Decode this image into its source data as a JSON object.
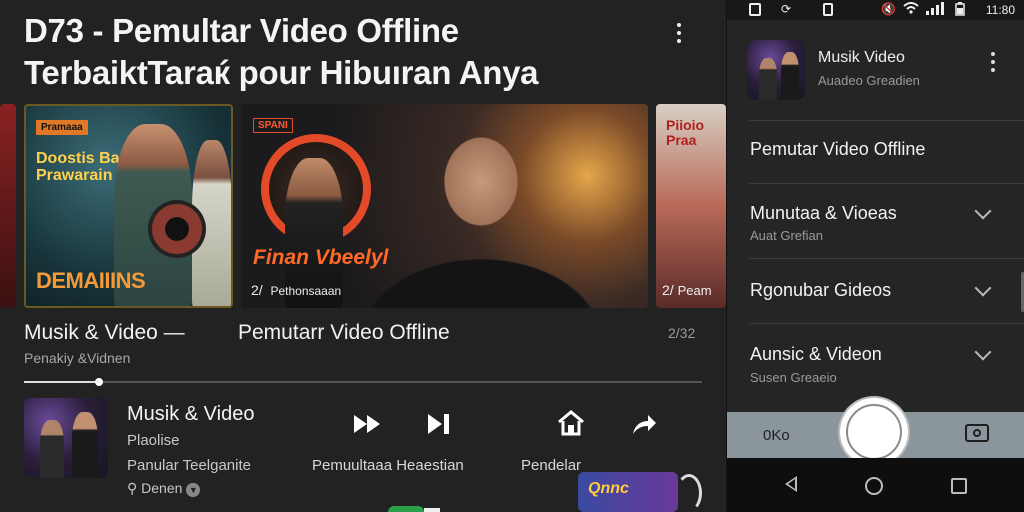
{
  "header": {
    "title_line1": "D73 - Pemultar Video Offline",
    "title_line2": "TerbaiktTaraќ pour Hibuıran Anya"
  },
  "carousel": {
    "items": [
      {
        "badge": "Pramaaa",
        "poster_text": "Doostis Bac Prawarain",
        "poster_bottom": "DEMAIIINS"
      },
      {
        "badge": "SPANI",
        "poster_text": "Finan Vbeelyl",
        "counter": "2/",
        "caption_overlay": "Pethonsaaan"
      },
      {
        "poster_text": "Piioio Praa",
        "counter": "2/",
        "caption_overlay": "Peam"
      }
    ],
    "captions": [
      {
        "title": "Musik & Video —",
        "sub": "Penakiy &Vidnen"
      },
      {
        "title": "Pemutarr Video Offline"
      }
    ],
    "page_indicator": "2/32",
    "progress": 0.11
  },
  "now_playing": {
    "title": "Musik & Video",
    "line1": "Plaolise",
    "line2": "Panular Teelganite",
    "line3": "Denen",
    "buttons": [
      {
        "name": "fast-forward-icon",
        "label": "Pemuultaaa Heaestian"
      },
      {
        "name": "skip-next-icon",
        "label": ""
      },
      {
        "name": "home-icon",
        "label": "Pendelar"
      },
      {
        "name": "share-icon",
        "label": ""
      }
    ],
    "floating_card": "Qnnc"
  },
  "status_bar": {
    "time": "11:80",
    "icons": [
      "notification-icon",
      "sync-icon",
      "lock-icon",
      "mute-icon",
      "wifi-icon",
      "signal-icon",
      "battery-icon"
    ]
  },
  "panel": {
    "header": {
      "title": "Musik Video",
      "sub": "Auadeo Greadien"
    },
    "menu": [
      {
        "title": "Pemutar Video Offline",
        "sub": "",
        "expandable": false
      },
      {
        "title": "Munutaa & Vioeas",
        "sub": "Auat Grefian",
        "expandable": true
      },
      {
        "title": "Rgonubar Gideos",
        "sub": "",
        "expandable": true
      },
      {
        "title": "Aunsic & Videon",
        "sub": "Susen Greaeio",
        "expandable": true
      }
    ],
    "bottom_left": "0Ko"
  },
  "colors": {
    "background": "#222222",
    "panel": "#252525",
    "bottom_bar": "#8a959c",
    "accent_orange": "#e07828"
  }
}
